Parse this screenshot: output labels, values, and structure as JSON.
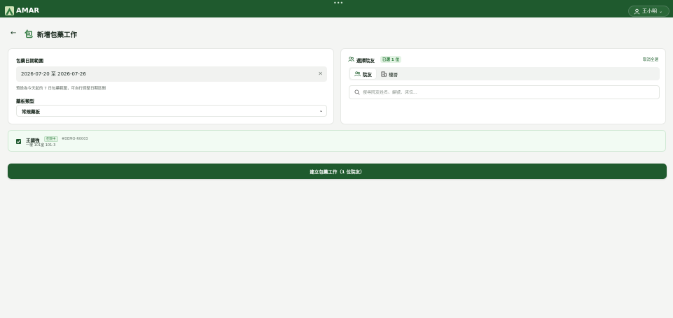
{
  "topbar": {
    "brand": "AMAR",
    "more_icon": "more-horizontal-icon",
    "user_label": "王小明"
  },
  "header": {
    "back_icon": "arrow-left-icon",
    "title_icon_char": "包",
    "title": "新增包藥工作"
  },
  "date_range": {
    "label": "包藥日期範圍",
    "value": "2026-07-20 至 2026-07-26",
    "hint": "預設為今天起的 7 日包藥範圍，可自行調整日期區間"
  },
  "type": {
    "label": "藥板類型",
    "selected": "常規藥板"
  },
  "select_residents": {
    "label": "選擇院友",
    "badge": "已選 1 位",
    "clear_all": "取消全選",
    "tabs": [
      {
        "label": "院友",
        "icon": "users-icon"
      },
      {
        "label": "樓層",
        "icon": "building-icon"
      }
    ],
    "search_placeholder": "搜尋院友姓名、編號、床位..."
  },
  "selected_list": [
    {
      "name": "王國強",
      "status": "在院中",
      "id": "#DEMO-R0003",
      "location": "一樓 101室 101-3",
      "checked": true
    }
  ],
  "submit": {
    "label": "建立包藥工作（1 位院友）"
  },
  "colors": {
    "primary": "#1f5a2e",
    "accent": "#2a7a3a",
    "background": "#f4f5f3"
  }
}
